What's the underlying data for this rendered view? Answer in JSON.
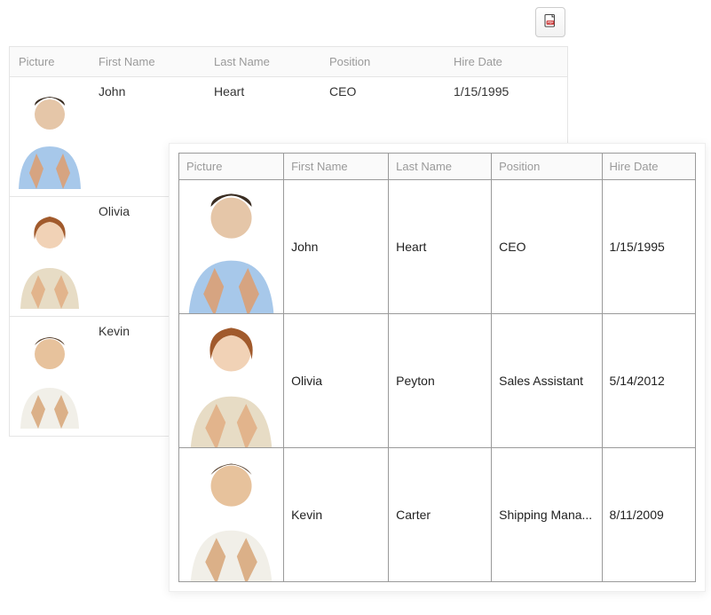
{
  "columns": {
    "picture": "Picture",
    "first_name": "First Name",
    "last_name": "Last Name",
    "position": "Position",
    "hire_date": "Hire Date"
  },
  "back_rows": [
    {
      "first_name": "John",
      "last_name": "Heart",
      "position": "CEO",
      "hire_date": "1/15/1995"
    },
    {
      "first_name": "Olivia",
      "last_name": "",
      "position": "",
      "hire_date": ""
    },
    {
      "first_name": "Kevin",
      "last_name": "",
      "position": "",
      "hire_date": ""
    }
  ],
  "front_rows": [
    {
      "first_name": "John",
      "last_name": "Heart",
      "position": "CEO",
      "hire_date": "1/15/1995"
    },
    {
      "first_name": "Olivia",
      "last_name": "Peyton",
      "position": "Sales Assistant",
      "hire_date": "5/14/2012"
    },
    {
      "first_name": "Kevin",
      "last_name": "Carter",
      "position": "Shipping Mana...",
      "hire_date": "8/11/2009"
    }
  ],
  "icons": {
    "pdf": "pdf-icon"
  }
}
